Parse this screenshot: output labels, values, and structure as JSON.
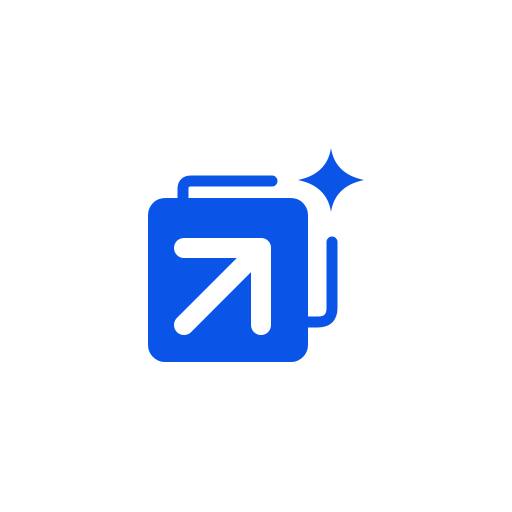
{
  "icon": {
    "name": "stacked-arrow-sparkle-logo",
    "parts": [
      "back-card-outline",
      "front-card",
      "up-right-arrow",
      "sparkle-star"
    ]
  },
  "colors": {
    "background": "#ffffff",
    "brand_blue": "#0a55e8",
    "arrow": "#ffffff"
  }
}
